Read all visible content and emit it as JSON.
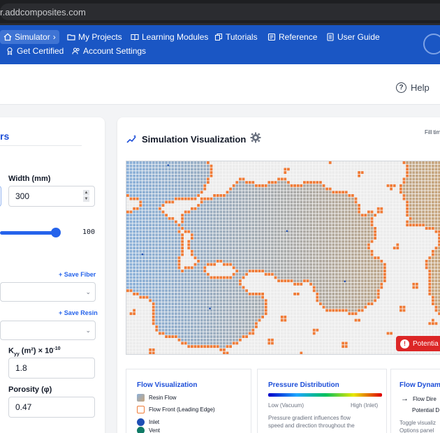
{
  "browser": {
    "url": "r.addcomposites.com"
  },
  "nav": {
    "items": [
      {
        "label": "Simulator",
        "icon": "home-icon"
      },
      {
        "label": "My Projects",
        "icon": "folder-icon"
      },
      {
        "label": "Learning Modules",
        "icon": "book-icon"
      },
      {
        "label": "Tutorials",
        "icon": "copy-icon"
      },
      {
        "label": "Reference",
        "icon": "document-icon"
      },
      {
        "label": "User Guide",
        "icon": "guide-icon"
      },
      {
        "label": "Get Certified",
        "icon": "award-icon"
      },
      {
        "label": "Account Settings",
        "icon": "users-icon"
      }
    ],
    "simulator_chevron": "›"
  },
  "header": {
    "help_label": "Help"
  },
  "parameters": {
    "title_fragment": "rs",
    "width_label": "Width (mm)",
    "width_value": "300",
    "slider_value": "100",
    "save_fiber": "+ Save Fiber",
    "save_resin": "+ Save Resin",
    "kyy_label": "K",
    "kyy_sub": "yy",
    "kyy_unit": " (m²) × 10",
    "kyy_exp": "-10",
    "kyy_value": "1.8",
    "porosity_label": "Porosity (φ)",
    "porosity_value": "0.47"
  },
  "visualization": {
    "title": "Simulation Visualization",
    "fill_time_fragment": "Fill tim",
    "warning_fragment": "Potentia"
  },
  "legend": {
    "flow_title": "Flow Visualization",
    "flow_items": [
      "Resin Flow",
      "Flow Front (Leading Edge)",
      "Inlet",
      "Vent"
    ],
    "pressure_title": "Pressure Distribution",
    "pressure_low": "Low (Vacuum)",
    "pressure_high": "High (Inlet)",
    "pressure_desc_1": "Pressure gradient influences flow",
    "pressure_desc_2": "speed and direction throughout the",
    "dyn_title": "Flow Dynami",
    "dyn_item_1": "Flow Dire",
    "dyn_item_2": "Potential D",
    "dyn_desc_1": "Toggle visualiz",
    "dyn_desc_2": "Options panel"
  },
  "colors": {
    "nav_bg": "#1a56c4",
    "accent": "#2563eb",
    "flow_front": "#ef7b37",
    "warning": "#dc2626"
  }
}
